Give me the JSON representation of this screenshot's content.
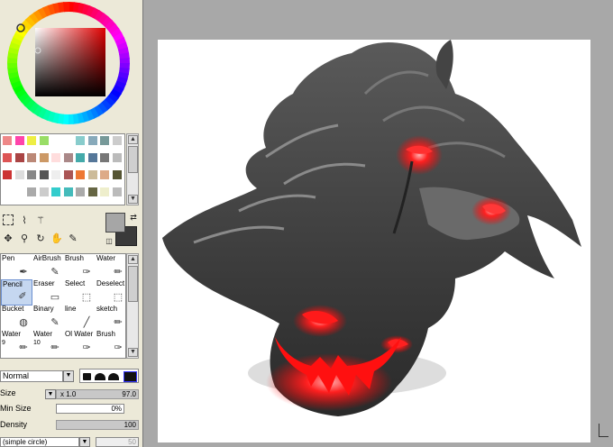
{
  "swatch_colors": [
    "#e88",
    "#f4a",
    "#ee4",
    "#9d6",
    "#fff",
    "#fff",
    "#8cc",
    "#8ab",
    "#799",
    "#ccc",
    "#d55",
    "#a44",
    "#b87",
    "#c96",
    "#fdd",
    "#a88",
    "#4aa",
    "#579",
    "#777",
    "#bbb",
    "#c33",
    "#ddd",
    "#888",
    "#555",
    "#eee",
    "#a55",
    "#e73",
    "#cb9",
    "#da8",
    "#553",
    "#fff",
    "#fff",
    "#aaa",
    "#ccc",
    "#3cc",
    "#4bb",
    "#aaa",
    "#664",
    "#eec",
    "#bbb"
  ],
  "tools": {
    "foreground_color": "#a6a6a6",
    "background_color": "#3a3a3a"
  },
  "brushes": [
    {
      "label": "Pen",
      "sub": "",
      "icon": "pen-icon"
    },
    {
      "label": "AirBrush",
      "sub": "",
      "icon": "airbrush-icon"
    },
    {
      "label": "Brush",
      "sub": "",
      "icon": "brush-icon"
    },
    {
      "label": "Water",
      "sub": "",
      "icon": "water-icon"
    },
    {
      "label": "Pencil",
      "sub": "",
      "icon": "pencil-icon",
      "selected": true
    },
    {
      "label": "Eraser",
      "sub": "",
      "icon": "eraser-icon"
    },
    {
      "label": "Select",
      "sub": "",
      "icon": "select-icon"
    },
    {
      "label": "Deselect",
      "sub": "",
      "icon": "deselect-icon"
    },
    {
      "label": "Bucket",
      "sub": "",
      "icon": "bucket-icon"
    },
    {
      "label": "Binary",
      "sub": "",
      "icon": "binary-icon"
    },
    {
      "label": "line",
      "sub": "",
      "icon": "line-icon"
    },
    {
      "label": "sketch",
      "sub": "",
      "icon": "sketch-icon"
    },
    {
      "label": "Water",
      "sub": "9",
      "icon": "water-icon"
    },
    {
      "label": "Water",
      "sub": "10",
      "icon": "water-icon"
    },
    {
      "label": "Ol Water",
      "sub": "",
      "icon": "oil-water-icon"
    },
    {
      "label": "Brush",
      "sub": "",
      "icon": "brush-icon"
    }
  ],
  "properties": {
    "blend_mode": "Normal",
    "size_label": "Size",
    "size_multiplier": "x 1.0",
    "size_value": "97.0",
    "min_size_label": "Min Size",
    "min_size_value": "0%",
    "density_label": "Density",
    "density_value": "100",
    "shape": "(simple circle)",
    "shape_value": "50"
  },
  "colors": {
    "workspace": "#a8a8a8",
    "panel": "#ece9d8",
    "selection": "#c5d7f0",
    "glow": "#ff1a1a"
  }
}
